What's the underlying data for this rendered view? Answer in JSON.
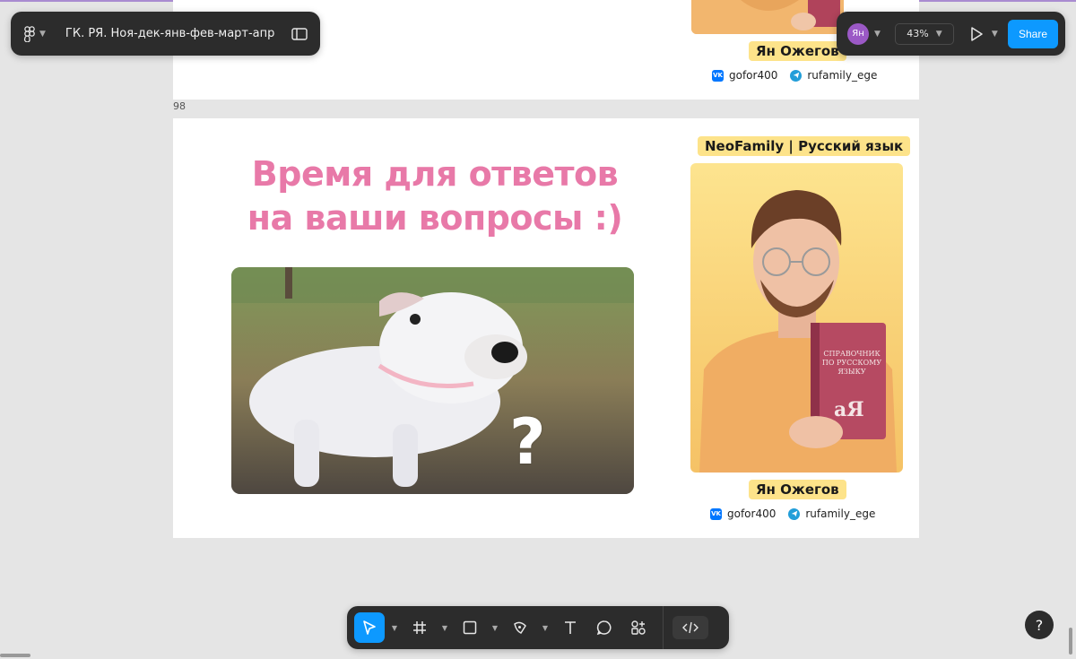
{
  "app": {
    "file_title": "ГК. РЯ. Ноя-дек-янв-фев-март-апр",
    "icons": {
      "menu": "figma-logo-icon",
      "sidebar": "sidebar-toggle-icon"
    }
  },
  "header_right": {
    "avatar_initials": "Ян",
    "zoom_level": "43%",
    "share_label": "Share"
  },
  "canvas": {
    "frame_number": "98",
    "top_frame": {
      "name_tag": "Ян Ожегов",
      "vk_handle": "gofor400",
      "tg_handle": "rufamily_ege"
    },
    "main_frame": {
      "headline_line1": "Время для ответов",
      "headline_line2": "на ваши вопросы :)",
      "brand_tag": "NeoFamily | Русский язык",
      "book_title": "СПРАВОЧНИК ПО РУССКОМУ ЯЗЫКУ",
      "book_letters": "аЯ",
      "meme_mark": "?",
      "name_tag": "Ян Ожегов",
      "vk_handle": "gofor400",
      "tg_handle": "rufamily_ege"
    }
  },
  "toolbar": {
    "tools": [
      "move-tool",
      "frame-tool",
      "shape-tool",
      "pen-tool",
      "text-tool",
      "comment-tool",
      "actions-tool"
    ],
    "help_label": "?"
  },
  "colors": {
    "headline": "#e879a8",
    "accent": "#0d99ff",
    "name_tag_bg": "#fde38a",
    "avatar": "#9b59c6"
  }
}
